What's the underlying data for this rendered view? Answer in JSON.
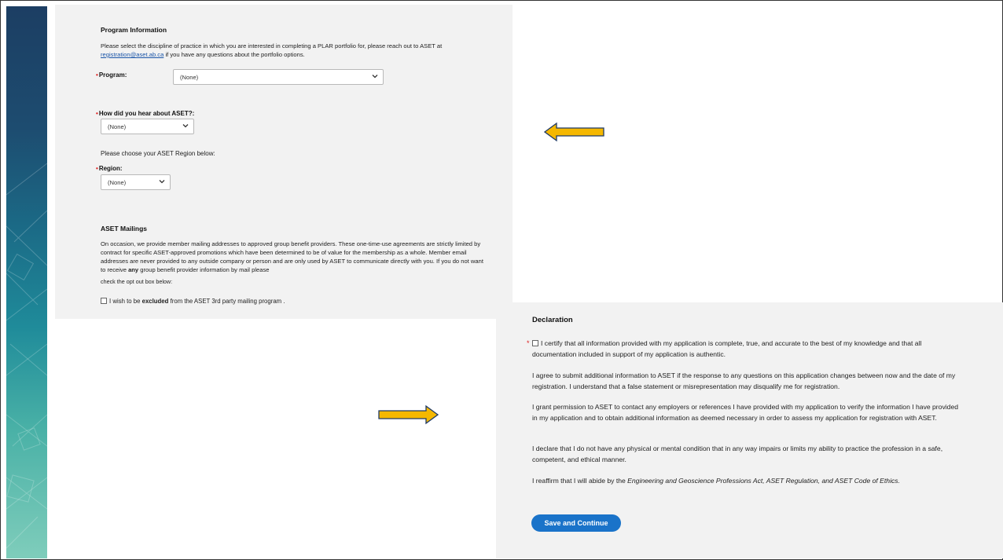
{
  "program_info": {
    "heading": "Program Information",
    "intro_before_link": "Please select the discipline of practice in which you are interested in completing a PLAR portfolio for, please reach out to ASET at",
    "email_link": "registration@aset.ab.ca",
    "intro_after_link": "if you have any questions about the portfolio options.",
    "program_label": "Program:",
    "program_value": "(None)",
    "hear_label": "How did you hear about ASET?:",
    "hear_value": "(None)",
    "region_prompt": "Please choose your ASET Region below:",
    "region_label": "Region:",
    "region_value": "(None)"
  },
  "mailings": {
    "heading": "ASET Mailings",
    "text_before_bold": "On occasion, we provide member mailing addresses to approved group benefit providers. These one-time-use agreements are strictly limited by contract for specific ASET-approved promotions which have been determined to be of value for the membership as a whole. Member email addresses are never provided to any outside company or person and are only used by ASET to communicate directly with you. If you do not want to receive",
    "text_bold": "any",
    "text_after_bold": "group benefit provider information by mail please",
    "text_line2": "check the opt out box below:",
    "optout_before": "I wish to be",
    "optout_bold": "excluded",
    "optout_after": "from the ASET 3rd party mailing program ."
  },
  "declaration": {
    "heading": "Declaration",
    "certify": "I certify that all information provided with my application is complete, true, and accurate to the best of my knowledge and that all documentation included in support of my application is authentic.",
    "p2": "I agree to submit additional information to ASET if the response to any questions on this application changes between now and the date of my registration. I understand that a false statement or misrepresentation may disqualify me for registration.",
    "p3": "I grant permission to ASET to contact any employers or references I have provided with my application to verify the information I have provided in my application and to obtain additional information as deemed necessary in order to assess my application for registration with ASET.",
    "p4": "I declare that I do not have any physical or mental condition that in any way impairs or limits my ability to practice the profession in a safe, competent, and ethical manner.",
    "p5_before": "I reaffirm that I will abide by the",
    "p5_italic": "Engineering and Geoscience Professions Act, ASET Regulation, and ASET Code of Ethics.",
    "save_button": "Save and Continue"
  },
  "colors": {
    "arrow_fill": "#f5b800",
    "arrow_stroke": "#1f3a66",
    "button": "#1a73c9",
    "required": "#dd2222"
  }
}
